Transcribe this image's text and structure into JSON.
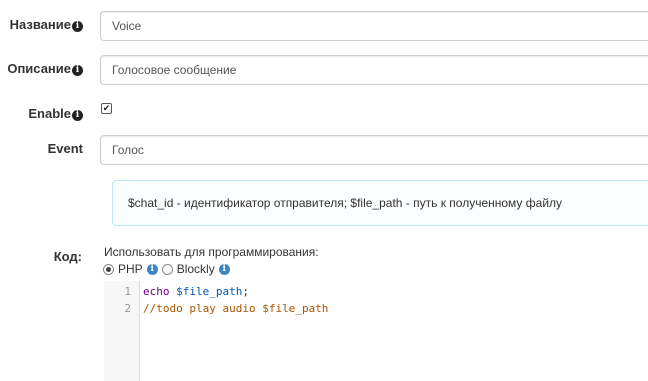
{
  "form": {
    "name": {
      "label": "Название",
      "value": "Voice"
    },
    "description": {
      "label": "Описание",
      "value": "Голосовое сообщение"
    },
    "enable": {
      "label": "Enable",
      "checked": true
    },
    "event": {
      "label": "Event",
      "value": "Голос"
    },
    "help": "$chat_id - идентификатор отправителя; $file_path - путь к полученному файлу",
    "code": {
      "label": "Код:",
      "intro": "Использовать для программирования:",
      "options": [
        {
          "label": "PHP",
          "selected": true
        },
        {
          "label": "Blockly",
          "selected": false
        }
      ],
      "lines": [
        {
          "number": "1",
          "tokens": [
            "echo",
            " ",
            "$file_path",
            ";"
          ]
        },
        {
          "number": "2",
          "text": "//todo play audio $file_path"
        }
      ]
    }
  },
  "icons": {
    "info": "info-icon",
    "check": "check-icon"
  },
  "colors": {
    "border": "#cccccc",
    "help_border": "#bce8f1",
    "info_blue": "#3a87c8",
    "keyword": "#770088",
    "variable": "#0055aa",
    "comment": "#aa5500"
  }
}
